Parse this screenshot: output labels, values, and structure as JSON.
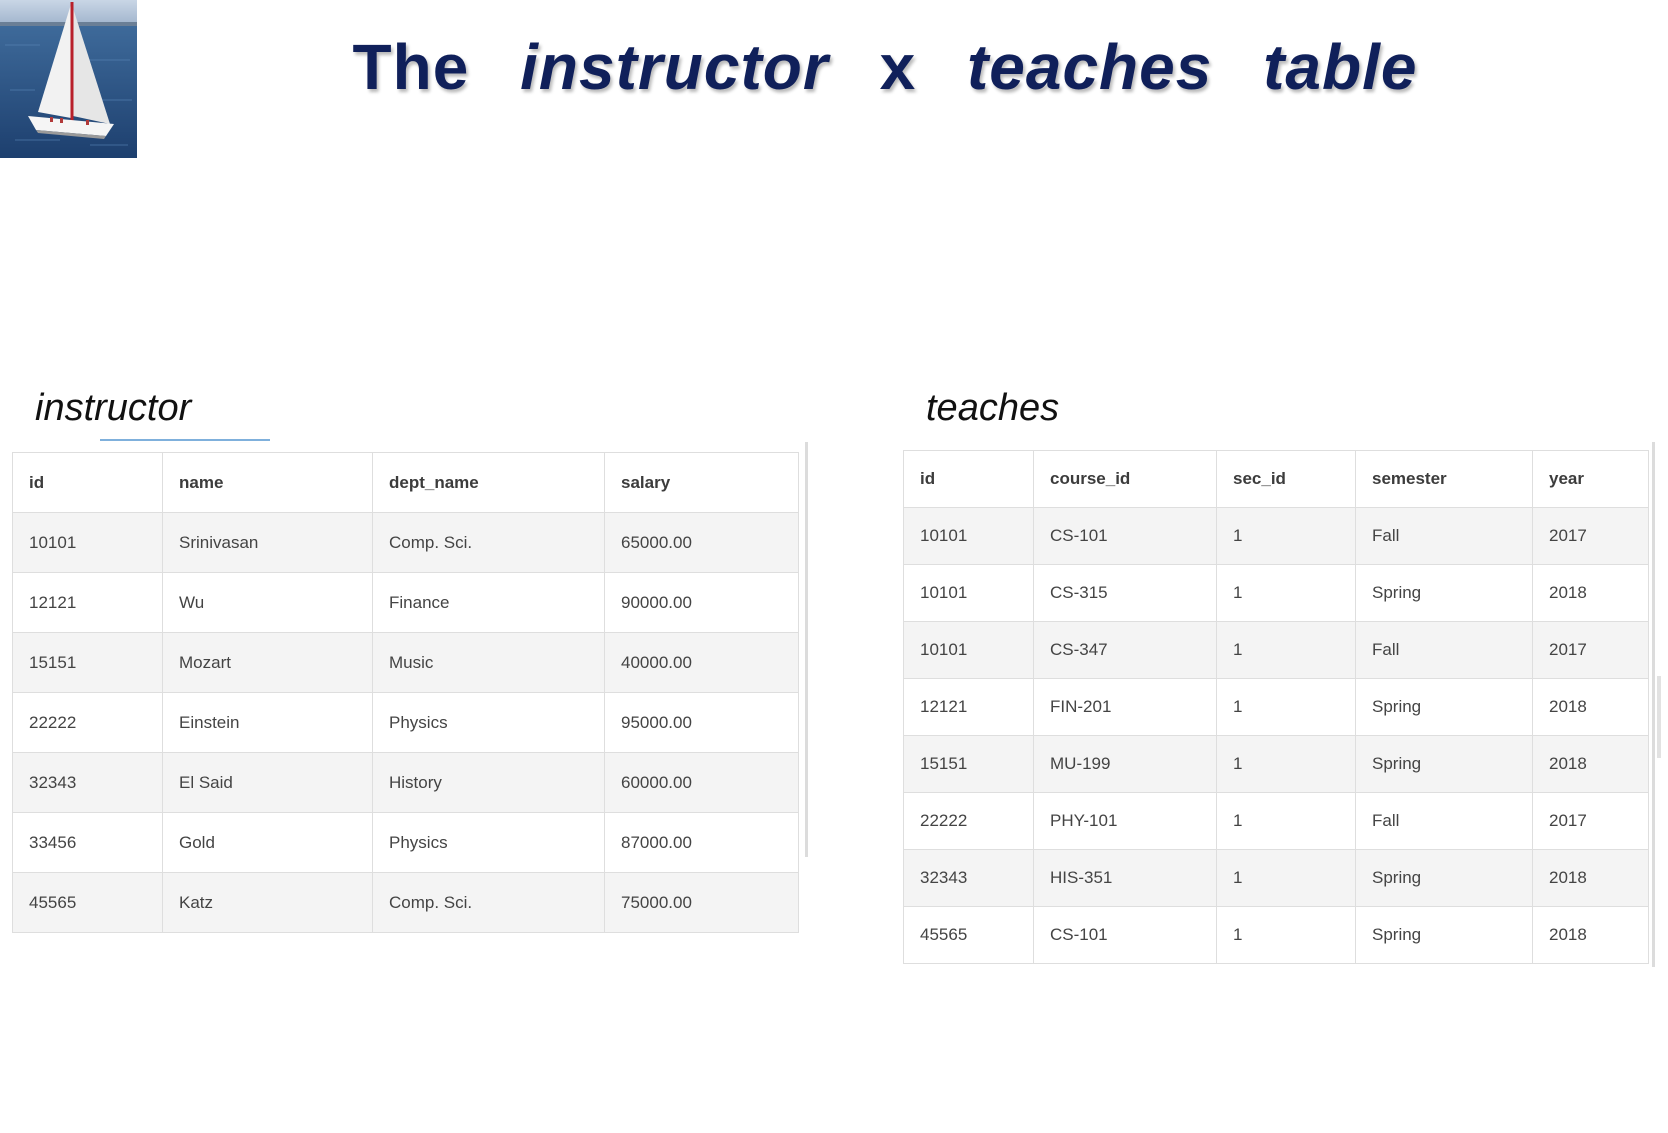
{
  "title": {
    "word1": "The",
    "word2": "instructor",
    "word3": "x",
    "word4": "teaches",
    "word5": "table"
  },
  "instructor": {
    "caption": "instructor",
    "columns": [
      "id",
      "name",
      "dept_name",
      "salary"
    ],
    "rows": [
      [
        "10101",
        "Srinivasan",
        "Comp. Sci.",
        "65000.00"
      ],
      [
        "12121",
        "Wu",
        "Finance",
        "90000.00"
      ],
      [
        "15151",
        "Mozart",
        "Music",
        "40000.00"
      ],
      [
        "22222",
        "Einstein",
        "Physics",
        "95000.00"
      ],
      [
        "32343",
        "El Said",
        "History",
        "60000.00"
      ],
      [
        "33456",
        "Gold",
        "Physics",
        "87000.00"
      ],
      [
        "45565",
        "Katz",
        "Comp. Sci.",
        "75000.00"
      ]
    ]
  },
  "teaches": {
    "caption": "teaches",
    "columns": [
      "id",
      "course_id",
      "sec_id",
      "semester",
      "year"
    ],
    "rows": [
      [
        "10101",
        "CS-101",
        "1",
        "Fall",
        "2017"
      ],
      [
        "10101",
        "CS-315",
        "1",
        "Spring",
        "2018"
      ],
      [
        "10101",
        "CS-347",
        "1",
        "Fall",
        "2017"
      ],
      [
        "12121",
        "FIN-201",
        "1",
        "Spring",
        "2018"
      ],
      [
        "15151",
        "MU-199",
        "1",
        "Spring",
        "2018"
      ],
      [
        "22222",
        "PHY-101",
        "1",
        "Fall",
        "2017"
      ],
      [
        "32343",
        "HIS-351",
        "1",
        "Spring",
        "2018"
      ],
      [
        "45565",
        "CS-101",
        "1",
        "Spring",
        "2018"
      ]
    ]
  },
  "colors": {
    "title": "#10205a",
    "row_alt": "#f4f4f4",
    "border": "#dedede",
    "underline": "#7fb0dc"
  }
}
